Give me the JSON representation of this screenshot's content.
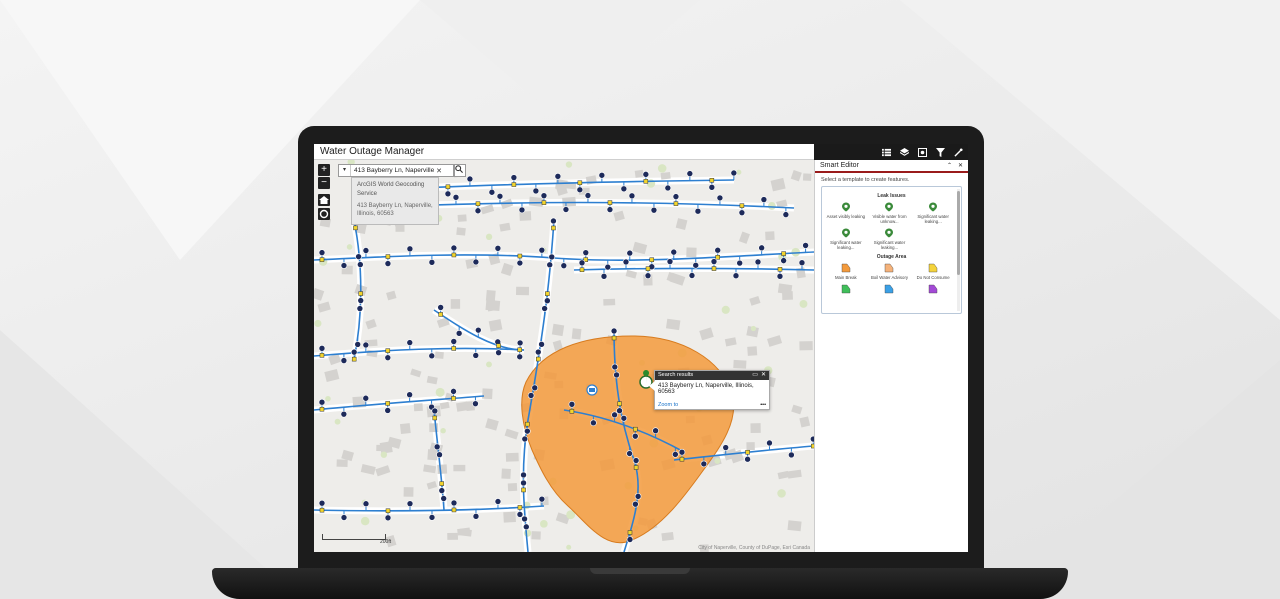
{
  "app": {
    "title": "Water Outage Manager"
  },
  "toolbar": {
    "tools": [
      {
        "name": "list-icon"
      },
      {
        "name": "layers-icon"
      },
      {
        "name": "basemap-icon"
      },
      {
        "name": "filter-icon"
      },
      {
        "name": "edit-icon"
      }
    ],
    "toolbar_bg": "#1a1a1a"
  },
  "search": {
    "value": "413 Bayberry Ln, Naperville",
    "clear_symbol": "✕",
    "go_symbol": "🔍",
    "dropdown_symbol": "▾",
    "suggestion_source": "ArcGIS World Geocoding Service",
    "suggestion_address": "413 Bayberry Ln, Naperville, Illinois, 60563"
  },
  "map_controls": {
    "zoom_in": "+",
    "zoom_out": "−",
    "home_icon": "home-icon",
    "locate_icon": "locate-icon"
  },
  "popup": {
    "title": "Search results",
    "address": "413 Bayberry Ln, Naperville, Illinois, 60563",
    "zoom_link": "Zoom to",
    "more": "•••",
    "dock_symbol": "▭",
    "close_symbol": "✕"
  },
  "map": {
    "scale_label": "200ft",
    "attribution": "City of Naperville, County of DuPage, Esri Canada",
    "colors": {
      "pipe": "#2d7fd0",
      "outage_area": "#f39a3c",
      "valve": "#f2d52e",
      "node": "#1d2a5a",
      "roads": "#ffffff",
      "buildings": "#d4d2cf"
    }
  },
  "panel": {
    "title": "Smart Editor",
    "ctrl_collapse": "⌃",
    "ctrl_close": "✕",
    "hint": "Select a template to create features.",
    "accent": "#9a1b1b",
    "groups": [
      {
        "title": "Leak Issues",
        "items": [
          {
            "label": "Asset visibly leaking",
            "color": "#3a8a3a",
            "icon": "leak-marker-icon"
          },
          {
            "label": "Visible water from unknow...",
            "color": "#3a8a3a",
            "icon": "leak-marker-icon"
          },
          {
            "label": "Significant water leaking...",
            "color": "#3a8a3a",
            "icon": "leak-marker-icon"
          },
          {
            "label": "Significant water leaking...",
            "color": "#3a8a3a",
            "icon": "leak-marker-icon"
          },
          {
            "label": "Significant water leaking...",
            "color": "#3a8a3a",
            "icon": "leak-marker-icon"
          }
        ]
      },
      {
        "title": "Outage Area",
        "items": [
          {
            "label": "Main Break",
            "color": "#f39a3c",
            "icon": "polygon-icon"
          },
          {
            "label": "Boil Water Advisory",
            "color": "#f5b27a",
            "icon": "polygon-icon"
          },
          {
            "label": "Do Not Consume",
            "color": "#f4d33c",
            "icon": "polygon-icon"
          },
          {
            "label": "",
            "color": "#3fbf5a",
            "icon": "polygon-icon"
          },
          {
            "label": "",
            "color": "#3aa0e6",
            "icon": "polygon-icon"
          },
          {
            "label": "",
            "color": "#a34ad6",
            "icon": "polygon-icon"
          }
        ]
      }
    ]
  }
}
